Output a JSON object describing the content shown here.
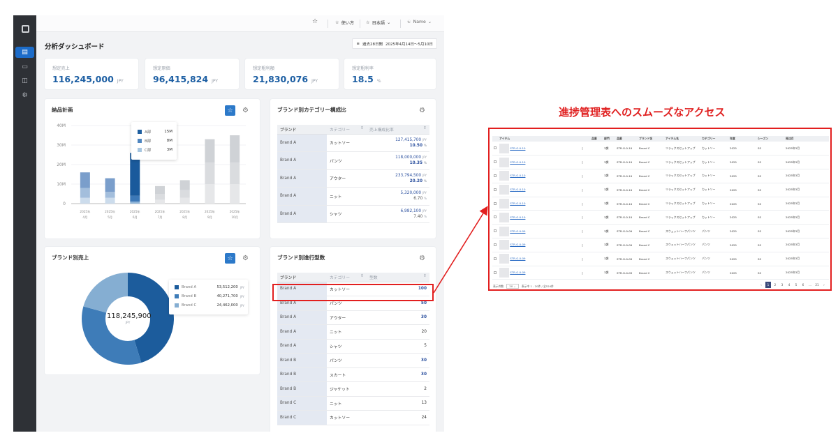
{
  "topbar": {
    "guide_label": "使い方",
    "language_label": "日本語",
    "user_label": "Name"
  },
  "page": {
    "title": "分析ダッシュボード",
    "period_label": "過去28日間",
    "period_range": "2025年4月14日〜5月10日"
  },
  "kpis": [
    {
      "label": "想定売上",
      "value": "116,245,000",
      "unit": "JPY"
    },
    {
      "label": "想定原価",
      "value": "96,415,824",
      "unit": "JPY"
    },
    {
      "label": "想定粗利額",
      "value": "21,830,076",
      "unit": "JPY"
    },
    {
      "label": "想定粗利率",
      "value": "18.5",
      "unit": "%"
    }
  ],
  "delivery_plan": {
    "title": "納品計画",
    "tooltip": [
      {
        "label": "A部",
        "value": "15M",
        "color": "#1f5fa0"
      },
      {
        "label": "B部",
        "value": "8M",
        "color": "#4f86c0"
      },
      {
        "label": "C部",
        "value": "3M",
        "color": "#a7c6e0"
      }
    ]
  },
  "chart_data": [
    {
      "type": "bar",
      "title": "納品計画",
      "categories": [
        "2025年\n4月",
        "2025年\n5月",
        "2025年\n6月",
        "2025年\n7月",
        "2025年\n8月",
        "2025年\n9月",
        "2025年\n10月"
      ],
      "ylim": [
        0,
        40
      ],
      "yticks": [
        "0",
        "10M",
        "20M",
        "30M",
        "40M"
      ],
      "series": [
        {
          "name": "A部",
          "values": [
            8,
            7,
            22,
            4,
            5,
            12,
            14
          ]
        },
        {
          "name": "B部",
          "values": [
            5,
            3,
            3,
            3,
            4,
            11,
            11
          ]
        },
        {
          "name": "C部",
          "values": [
            3,
            3,
            1,
            2,
            3,
            10,
            10
          ]
        }
      ],
      "highlight_index": 2,
      "grid": true
    },
    {
      "type": "pie",
      "title": "ブランド別売上",
      "center_value": "118,245,900",
      "center_unit": "JPY",
      "slices": [
        {
          "name": "Brand A",
          "value": 53512200,
          "label": "53,512,200",
          "color": "#1c5c9c"
        },
        {
          "name": "Brand B",
          "value": 40271700,
          "label": "40,271,700",
          "color": "#3e7cb8"
        },
        {
          "name": "Brand C",
          "value": 24462000,
          "label": "24,462,000",
          "color": "#85aed2"
        }
      ],
      "unit": "JPY"
    }
  ],
  "brand_category": {
    "title": "ブランド別カテゴリー構成比",
    "headers": [
      "ブランド",
      "カテゴリー",
      "売上構成比率"
    ],
    "rows": [
      {
        "brand": "Brand A",
        "category": "カットソー",
        "amount": "127,415,700",
        "pct": "10.50",
        "bold": true
      },
      {
        "brand": "Brand A",
        "category": "パンツ",
        "amount": "118,000,000",
        "pct": "10.35",
        "bold": true
      },
      {
        "brand": "Brand A",
        "category": "アウター",
        "amount": "233,794,500",
        "pct": "20.20",
        "bold": true
      },
      {
        "brand": "Brand A",
        "category": "ニット",
        "amount": "5,320,000",
        "pct": "6.70",
        "bold": false
      },
      {
        "brand": "Brand A",
        "category": "シャツ",
        "amount": "6,982,100",
        "pct": "7.40",
        "bold": false
      }
    ],
    "unit_amount": "JPY",
    "unit_pct": "%"
  },
  "brand_progress": {
    "title": "ブランド別進行型数",
    "headers": [
      "ブランド",
      "カテゴリー",
      "型数"
    ],
    "rows": [
      {
        "brand": "Brand A",
        "category": "カットソー",
        "count": "100"
      },
      {
        "brand": "Brand A",
        "category": "パンツ",
        "count": "50"
      },
      {
        "brand": "Brand A",
        "category": "アウター",
        "count": "30"
      },
      {
        "brand": "Brand A",
        "category": "ニット",
        "count": "20"
      },
      {
        "brand": "Brand A",
        "category": "シャツ",
        "count": "5"
      },
      {
        "brand": "Brand B",
        "category": "パンツ",
        "count": "30"
      },
      {
        "brand": "Brand B",
        "category": "スカート",
        "count": "30"
      },
      {
        "brand": "Brand B",
        "category": "ジャケット",
        "count": "2"
      },
      {
        "brand": "Brand C",
        "category": "ニット",
        "count": "13"
      },
      {
        "brand": "Brand C",
        "category": "カットソー",
        "count": "24"
      }
    ]
  },
  "callout": {
    "title": "進捗管理表へのスムーズなアクセス"
  },
  "progress_table": {
    "headers": [
      "アイテム",
      "品番",
      "部門",
      "品番",
      "ブランド名",
      "アイテム名",
      "カテゴリー",
      "年度",
      "シーズン",
      "発注月"
    ],
    "rows": [
      {
        "item": "STR-G-0-10",
        "dept": "3課",
        "code": "STR-G-0-10",
        "brand": "Brand C",
        "name": "リラックスセットアップ",
        "cat": "カットソー",
        "year": "2025",
        "season": "SS",
        "month": "2025年3月"
      },
      {
        "item": "STR-G-0-10",
        "dept": "3課",
        "code": "STR-G-0-10",
        "brand": "Brand C",
        "name": "リラックスセットアップ",
        "cat": "カットソー",
        "year": "2025",
        "season": "SS",
        "month": "2025年3月"
      },
      {
        "item": "STR-G-0-10",
        "dept": "3課",
        "code": "STR-G-0-10",
        "brand": "Brand C",
        "name": "リラックスセットアップ",
        "cat": "カットソー",
        "year": "2025",
        "season": "SS",
        "month": "2025年3月"
      },
      {
        "item": "STR-G-0-10",
        "dept": "3課",
        "code": "STR-G-0-10",
        "brand": "Brand C",
        "name": "リラックスセットアップ",
        "cat": "カットソー",
        "year": "2025",
        "season": "SS",
        "month": "2025年3月"
      },
      {
        "item": "STR-G-0-10",
        "dept": "3課",
        "code": "STR-G-0-10",
        "brand": "Brand C",
        "name": "リラックスセットアップ",
        "cat": "カットソー",
        "year": "2025",
        "season": "SS",
        "month": "2025年3月"
      },
      {
        "item": "STR-G-0-10",
        "dept": "3課",
        "code": "STR-G-0-10",
        "brand": "Brand C",
        "name": "リラックスセットアップ",
        "cat": "カットソー",
        "year": "2025",
        "season": "SS",
        "month": "2025年3月"
      },
      {
        "item": "STR-G-0-09",
        "dept": "3課",
        "code": "STR-G-0-09",
        "brand": "Brand C",
        "name": "スウェットハーフパンツ",
        "cat": "パンツ",
        "year": "2025",
        "season": "SS",
        "month": "2025年3月"
      },
      {
        "item": "STR-G-0-09",
        "dept": "3課",
        "code": "STR-G-0-09",
        "brand": "Brand C",
        "name": "スウェットハーフパンツ",
        "cat": "パンツ",
        "year": "2025",
        "season": "SS",
        "month": "2025年3月"
      },
      {
        "item": "STR-G-0-09",
        "dept": "3課",
        "code": "STR-G-0-09",
        "brand": "Brand C",
        "name": "スウェットハーフパンツ",
        "cat": "パンツ",
        "year": "2025",
        "season": "SS",
        "month": "2025年3月"
      },
      {
        "item": "STR-G-0-09",
        "dept": "3課",
        "code": "STR-G-0-09",
        "brand": "Brand C",
        "name": "スウェットハーフパンツ",
        "cat": "パンツ",
        "year": "2025",
        "season": "SS",
        "month": "2025年3月"
      }
    ],
    "per_page_label": "表示件数",
    "per_page": "20",
    "range_label": "表示中 1 - 20件 / 全524件",
    "pages": [
      "1",
      "2",
      "3",
      "4",
      "5",
      "6",
      "...",
      "21"
    ]
  },
  "colors": {
    "accent": "#2c79c9",
    "kpi_value": "#1d5fa3",
    "highlight": "#e21f1f",
    "sidebar": "#2e3136"
  }
}
